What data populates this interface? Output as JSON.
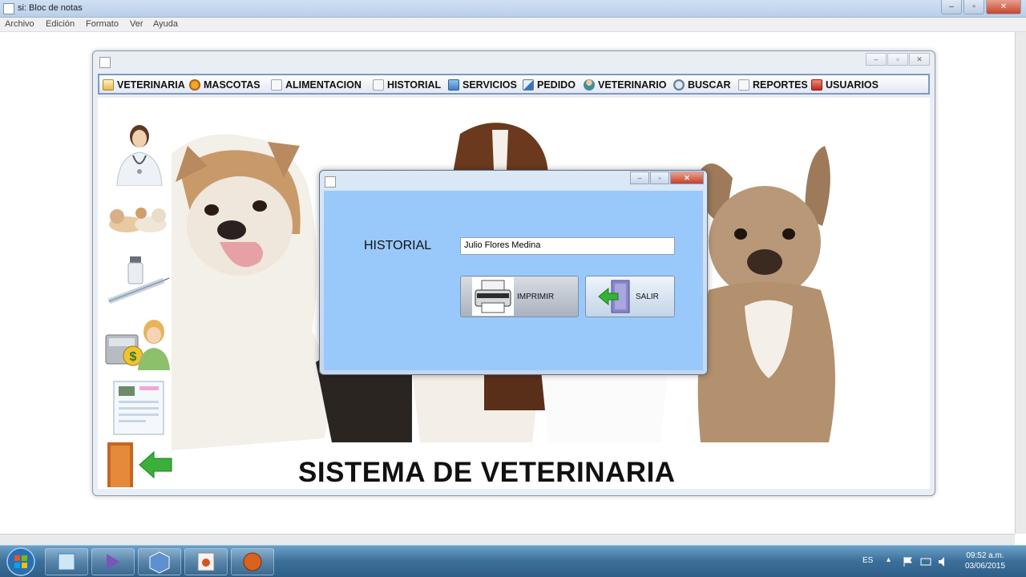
{
  "notepad": {
    "title": "si: Bloc de notas",
    "menu": [
      "Archivo",
      "Edición",
      "Formato",
      "Ver",
      "Ayuda"
    ]
  },
  "app": {
    "menubar": [
      {
        "label": "VETERINARIA",
        "icon": "folder-icon"
      },
      {
        "label": "MASCOTAS",
        "icon": "paw-icon"
      },
      {
        "label": "ALIMENTACION",
        "icon": "document-icon"
      },
      {
        "label": "HISTORIAL",
        "icon": "document-icon"
      },
      {
        "label": "SERVICIOS",
        "icon": "briefcase-icon"
      },
      {
        "label": "PEDIDO",
        "icon": "edit-document-icon"
      },
      {
        "label": "VETERINARIO",
        "icon": "user-icon"
      },
      {
        "label": "BUSCAR",
        "icon": "magnifier-icon"
      },
      {
        "label": "REPORTES",
        "icon": "report-icon"
      },
      {
        "label": "USUARIOS",
        "icon": "user-lock-icon"
      }
    ],
    "main_title": "SISTEMA DE VETERINARIA"
  },
  "dialog": {
    "label": "HISTORIAL",
    "input_value": "Julio Flores Medina",
    "print_button": "IMPRIMIR",
    "exit_button": "SALIR"
  },
  "taskbar": {
    "language": "ES",
    "time": "09:52 a.m.",
    "date": "03/06/2015"
  },
  "colors": {
    "dialog_body": "#99c9fa",
    "menubar_border": "#7d99c5",
    "taskbar": "#3b6f99"
  }
}
